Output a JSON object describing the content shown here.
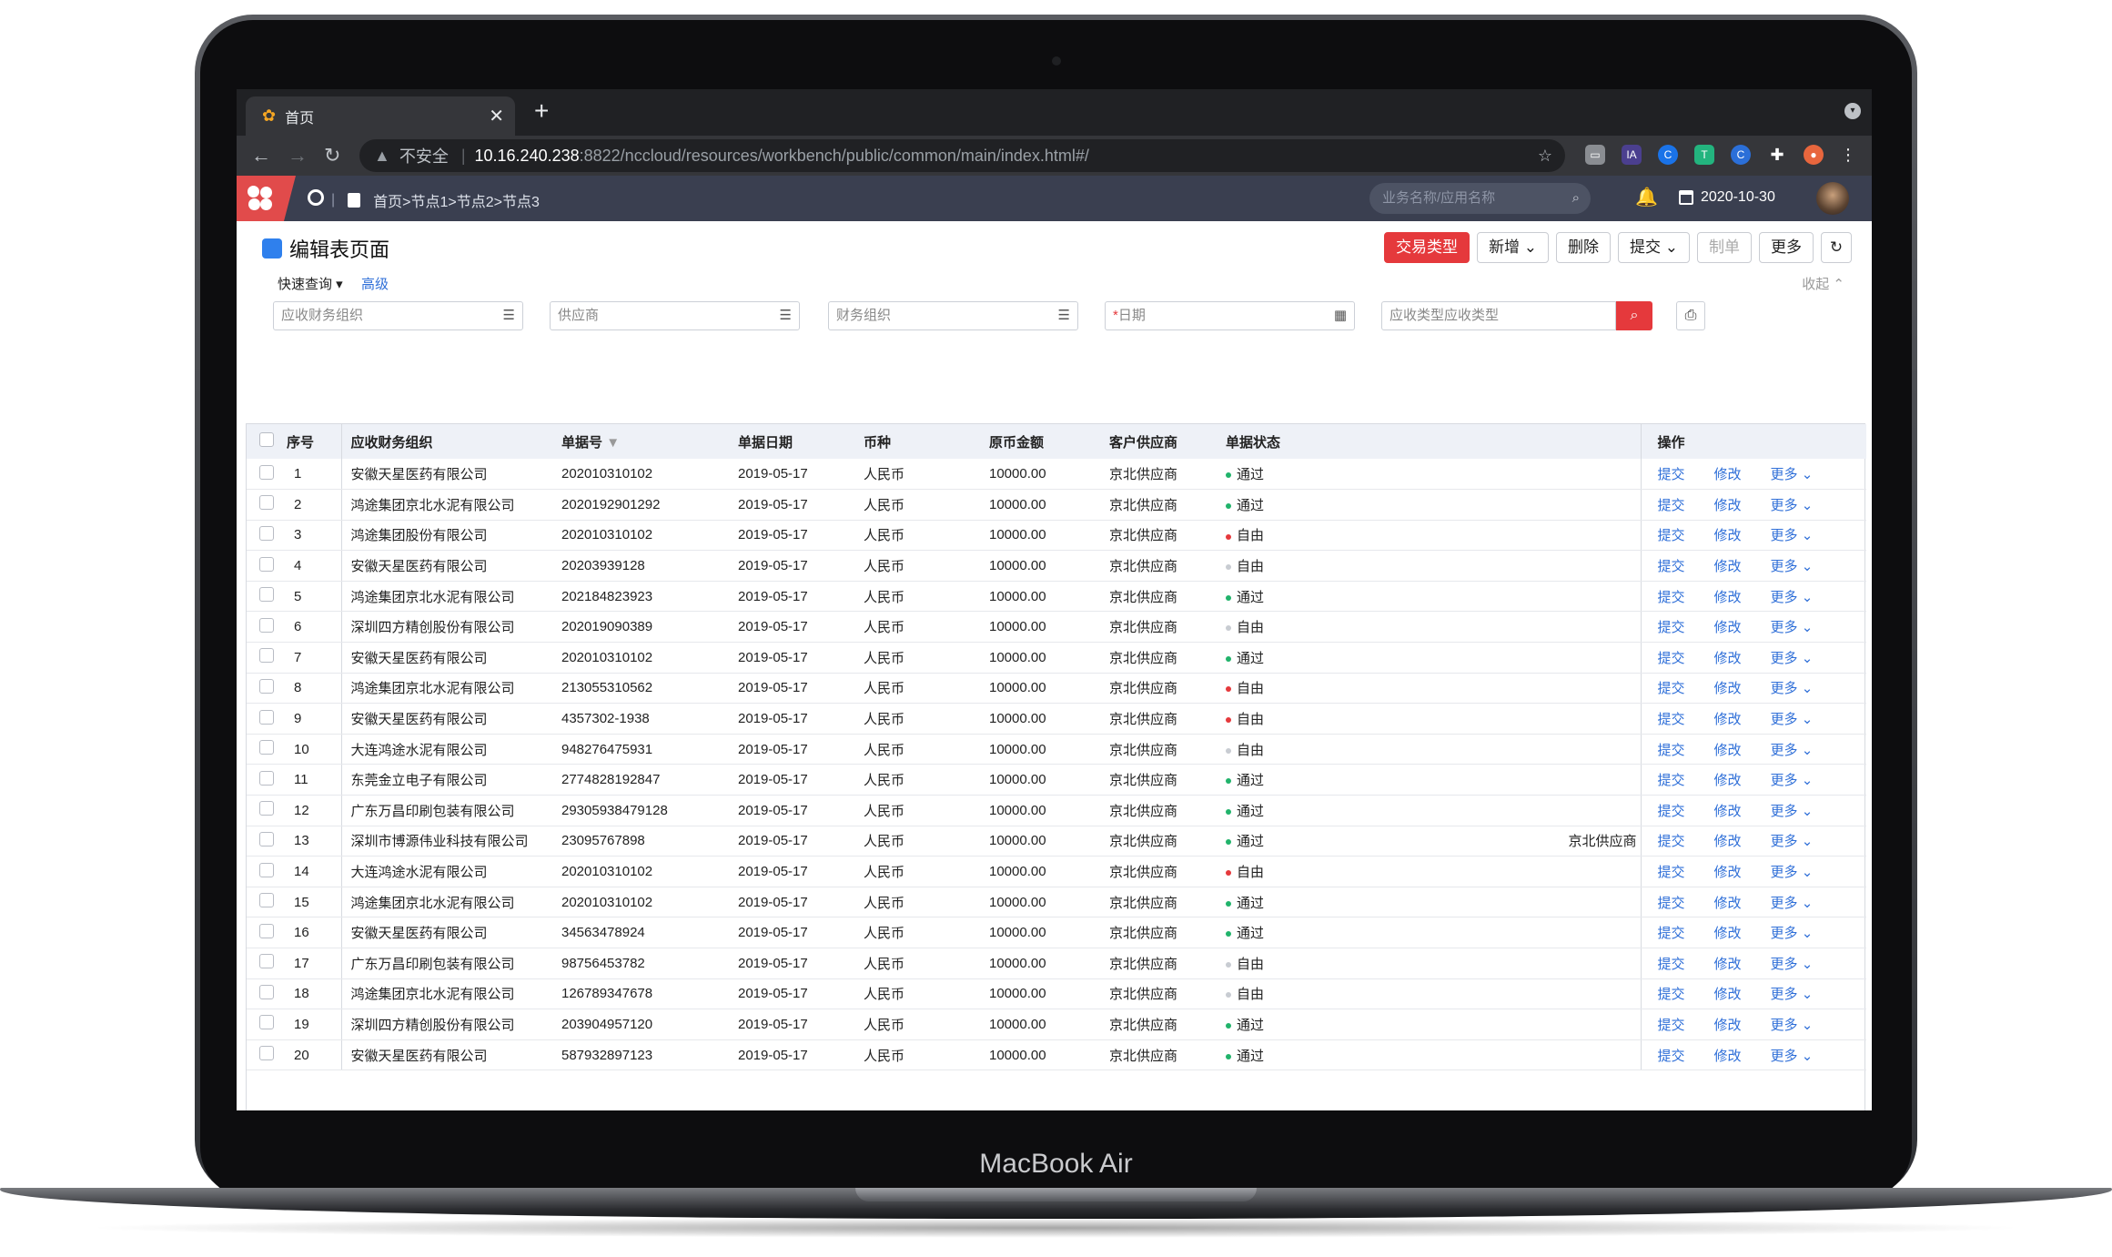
{
  "device": {
    "brand": "MacBook Air"
  },
  "browser": {
    "tab_title": "首页",
    "tab_close": "✕",
    "new_tab": "+",
    "security": "不安全",
    "url_host": "10.16.240.238",
    "url_path": ":8822/nccloud/resources/workbench/public/common/main/index.html#/"
  },
  "app": {
    "breadcrumb": "首页>节点1>节点2>节点3",
    "search_placeholder": "业务名称/应用名称",
    "date": "2020-10-30"
  },
  "page": {
    "title": "编辑表页面",
    "buttons": {
      "trade_type": "交易类型",
      "add": "新增",
      "delete": "删除",
      "submit": "提交",
      "make": "制单",
      "more": "更多"
    },
    "quick_query": "快速查询",
    "advanced": "高级",
    "collapse": "收起",
    "filters": {
      "org": "应收财务组织",
      "supplier": "供应商",
      "fin_org": "财务组织",
      "date": "日期",
      "type": "应收类型应收类型"
    }
  },
  "table": {
    "columns": [
      "序号",
      "应收财务组织",
      "单据号",
      "单据日期",
      "币种",
      "原币金额",
      "客户供应商",
      "单据状态",
      "操作"
    ],
    "actions": {
      "submit": "提交",
      "edit": "修改",
      "more": "更多"
    },
    "overflow_text": "京北供应商",
    "status_colors": {
      "通过": "#21b36b",
      "自由_red": "#e5393c",
      "自由_gray": "#c8ccd2"
    },
    "rows": [
      {
        "no": "1",
        "org": "安徽天星医药有限公司",
        "bill": "202010310102",
        "date": "2019-05-17",
        "cur": "人民币",
        "amt": "10000.00",
        "cust": "京北供应商",
        "status": "通过",
        "color": "#21b36b"
      },
      {
        "no": "2",
        "org": "鸿途集团京北水泥有限公司",
        "bill": "2020192901292",
        "date": "2019-05-17",
        "cur": "人民币",
        "amt": "10000.00",
        "cust": "京北供应商",
        "status": "通过",
        "color": "#21b36b"
      },
      {
        "no": "3",
        "org": "鸿途集团股份有限公司",
        "bill": "202010310102",
        "date": "2019-05-17",
        "cur": "人民币",
        "amt": "10000.00",
        "cust": "京北供应商",
        "status": "自由",
        "color": "#e5393c"
      },
      {
        "no": "4",
        "org": "安徽天星医药有限公司",
        "bill": "20203939128",
        "date": "2019-05-17",
        "cur": "人民币",
        "amt": "10000.00",
        "cust": "京北供应商",
        "status": "自由",
        "color": "#c8ccd2"
      },
      {
        "no": "5",
        "org": "鸿途集团京北水泥有限公司",
        "bill": "202184823923",
        "date": "2019-05-17",
        "cur": "人民币",
        "amt": "10000.00",
        "cust": "京北供应商",
        "status": "通过",
        "color": "#21b36b"
      },
      {
        "no": "6",
        "org": "深圳四方精创股份有限公司",
        "bill": "202019090389",
        "date": "2019-05-17",
        "cur": "人民币",
        "amt": "10000.00",
        "cust": "京北供应商",
        "status": "自由",
        "color": "#c8ccd2"
      },
      {
        "no": "7",
        "org": "安徽天星医药有限公司",
        "bill": "202010310102",
        "date": "2019-05-17",
        "cur": "人民币",
        "amt": "10000.00",
        "cust": "京北供应商",
        "status": "通过",
        "color": "#21b36b"
      },
      {
        "no": "8",
        "org": "鸿途集团京北水泥有限公司",
        "bill": "213055310562",
        "date": "2019-05-17",
        "cur": "人民币",
        "amt": "10000.00",
        "cust": "京北供应商",
        "status": "自由",
        "color": "#e5393c"
      },
      {
        "no": "9",
        "org": "安徽天星医药有限公司",
        "bill": "4357302-1938",
        "date": "2019-05-17",
        "cur": "人民币",
        "amt": "10000.00",
        "cust": "京北供应商",
        "status": "自由",
        "color": "#e5393c"
      },
      {
        "no": "10",
        "org": "大连鸿途水泥有限公司",
        "bill": "948276475931",
        "date": "2019-05-17",
        "cur": "人民币",
        "amt": "10000.00",
        "cust": "京北供应商",
        "status": "自由",
        "color": "#c8ccd2"
      },
      {
        "no": "11",
        "org": "东莞金立电子有限公司",
        "bill": "2774828192847",
        "date": "2019-05-17",
        "cur": "人民币",
        "amt": "10000.00",
        "cust": "京北供应商",
        "status": "通过",
        "color": "#21b36b"
      },
      {
        "no": "12",
        "org": "广东万昌印刷包装有限公司",
        "bill": "29305938479128",
        "date": "2019-05-17",
        "cur": "人民币",
        "amt": "10000.00",
        "cust": "京北供应商",
        "status": "通过",
        "color": "#21b36b"
      },
      {
        "no": "13",
        "org": "深圳市博源伟业科技有限公司",
        "bill": "23095767898",
        "date": "2019-05-17",
        "cur": "人民币",
        "amt": "10000.00",
        "cust": "京北供应商",
        "status": "通过",
        "color": "#21b36b"
      },
      {
        "no": "14",
        "org": "大连鸿途水泥有限公司",
        "bill": "202010310102",
        "date": "2019-05-17",
        "cur": "人民币",
        "amt": "10000.00",
        "cust": "京北供应商",
        "status": "自由",
        "color": "#e5393c"
      },
      {
        "no": "15",
        "org": "鸿途集团京北水泥有限公司",
        "bill": "202010310102",
        "date": "2019-05-17",
        "cur": "人民币",
        "amt": "10000.00",
        "cust": "京北供应商",
        "status": "通过",
        "color": "#21b36b"
      },
      {
        "no": "16",
        "org": "安徽天星医药有限公司",
        "bill": "34563478924",
        "date": "2019-05-17",
        "cur": "人民币",
        "amt": "10000.00",
        "cust": "京北供应商",
        "status": "通过",
        "color": "#21b36b"
      },
      {
        "no": "17",
        "org": "广东万昌印刷包装有限公司",
        "bill": "98756453782",
        "date": "2019-05-17",
        "cur": "人民币",
        "amt": "10000.00",
        "cust": "京北供应商",
        "status": "自由",
        "color": "#c8ccd2"
      },
      {
        "no": "18",
        "org": "鸿途集团京北水泥有限公司",
        "bill": "126789347678",
        "date": "2019-05-17",
        "cur": "人民币",
        "amt": "10000.00",
        "cust": "京北供应商",
        "status": "自由",
        "color": "#c8ccd2"
      },
      {
        "no": "19",
        "org": "深圳四方精创股份有限公司",
        "bill": "203904957120",
        "date": "2019-05-17",
        "cur": "人民币",
        "amt": "10000.00",
        "cust": "京北供应商",
        "status": "通过",
        "color": "#21b36b"
      },
      {
        "no": "20",
        "org": "安徽天星医药有限公司",
        "bill": "587932897123",
        "date": "2019-05-17",
        "cur": "人民币",
        "amt": "10000.00",
        "cust": "京北供应商",
        "status": "通过",
        "color": "#21b36b"
      }
    ]
  }
}
